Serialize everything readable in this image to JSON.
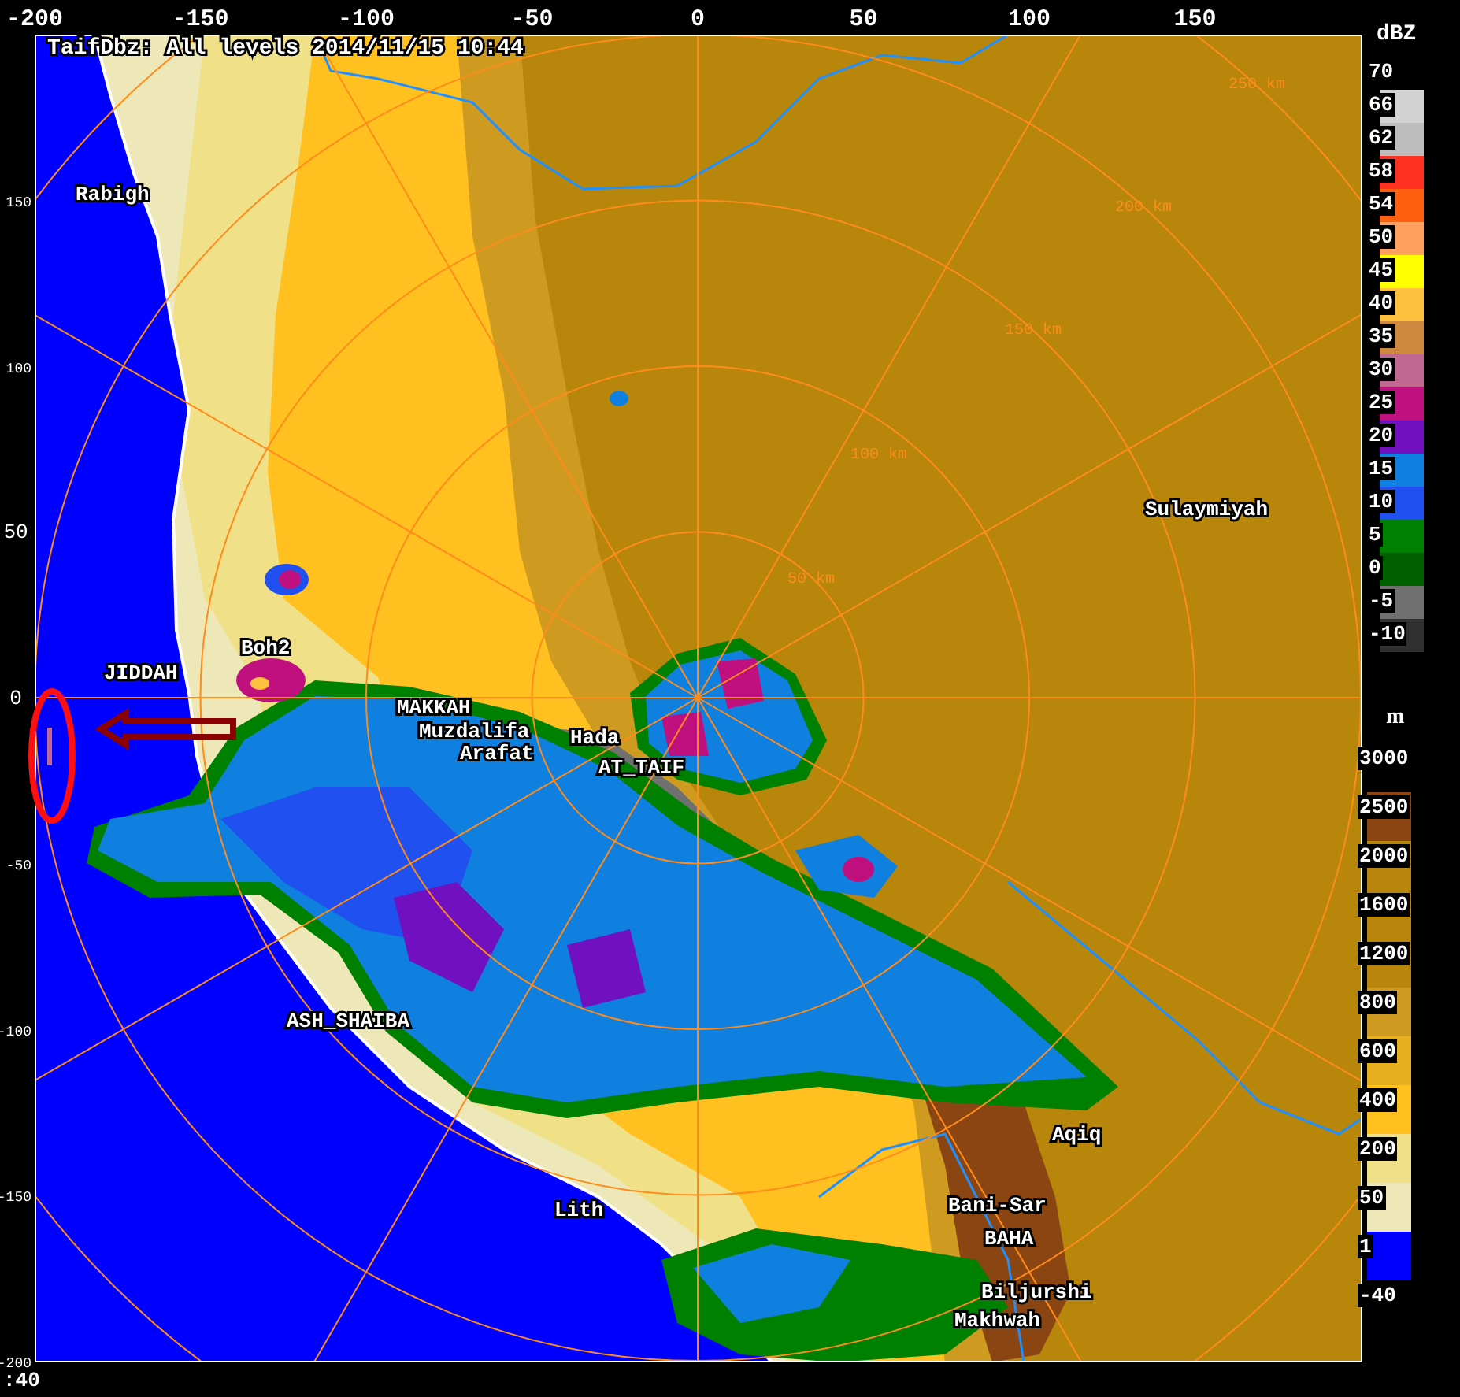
{
  "title": "TaifDbz: All levels 2014/11/15 10:44",
  "x_ticks": [
    "-200",
    "-150",
    "-100",
    "-50",
    "0",
    "50",
    "100",
    "150"
  ],
  "y_ticks": [
    "150",
    "100",
    "50",
    "0",
    "-50",
    "-100",
    "-150",
    "-200"
  ],
  "corner_text": ":40",
  "range_labels": [
    "50 km",
    "100 km",
    "150 km",
    "200 km",
    "250 km"
  ],
  "places": [
    "Rabigh",
    "Boh2",
    "JIDDAH",
    "MAKKAH",
    "Muzdalifa",
    "Arafat",
    "Hada",
    "AT_TAIF",
    "Sulaymiyah",
    "ASH_SHAIBA",
    "Lith",
    "Aqiq",
    "Bani-Sar",
    "BAHA",
    "Biljurshi",
    "Makhwah"
  ],
  "dbz_legend": {
    "unit": "dBZ",
    "entries": [
      {
        "label": "70"
      },
      {
        "label": "66",
        "color": "#d3d3d3"
      },
      {
        "label": "62",
        "color": "#bebebe"
      },
      {
        "label": "58",
        "color": "#ff3020"
      },
      {
        "label": "54",
        "color": "#ff6010"
      },
      {
        "label": "50",
        "color": "#ffa060"
      },
      {
        "label": "45",
        "color": "#ffff00"
      },
      {
        "label": "40",
        "color": "#ffc040"
      },
      {
        "label": "35",
        "color": "#d08840"
      },
      {
        "label": "30",
        "color": "#c06890"
      },
      {
        "label": "25",
        "color": "#c01080"
      },
      {
        "label": "20",
        "color": "#7010c0"
      },
      {
        "label": "15",
        "color": "#1080e0"
      },
      {
        "label": "10",
        "color": "#2050f0"
      },
      {
        "label": "5",
        "color": "#008000"
      },
      {
        "label": "0",
        "color": "#006000"
      },
      {
        "label": "-5",
        "color": "#707070"
      },
      {
        "label": "-10",
        "color": "#303030"
      }
    ]
  },
  "height_legend": {
    "unit": "m",
    "entries": [
      {
        "label": "3000"
      },
      {
        "label": "2500",
        "color": "#8b4513"
      },
      {
        "label": "2000",
        "color": "#b8860b"
      },
      {
        "label": "1600",
        "color": "#b8860b"
      },
      {
        "label": "1200",
        "color": "#b8860b"
      },
      {
        "label": "800",
        "color": "#cf9a20"
      },
      {
        "label": "600",
        "color": "#e8b020"
      },
      {
        "label": "400",
        "color": "#ffc020"
      },
      {
        "label": "200",
        "color": "#f0e088"
      },
      {
        "label": "50",
        "color": "#eee8b8"
      },
      {
        "label": "1",
        "color": "#0000ff"
      },
      {
        "label": "-40"
      }
    ]
  }
}
